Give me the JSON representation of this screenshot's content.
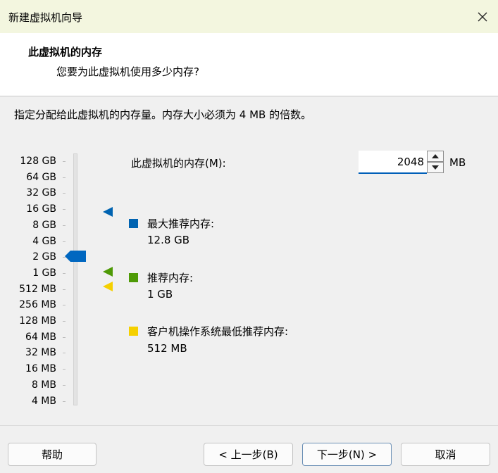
{
  "window": {
    "title": "新建虚拟机向导",
    "close_icon": "close-icon"
  },
  "header": {
    "title": "此虚拟机的内存",
    "subtitle": "您要为此虚拟机使用多少内存?"
  },
  "instruction": "指定分配给此虚拟机的内存量。内存大小必须为 4 MB 的倍数。",
  "slider": {
    "labels": [
      "128 GB",
      "64 GB",
      "32 GB",
      "16 GB",
      "8 GB",
      "4 GB",
      "2 GB",
      "1 GB",
      "512 MB",
      "256 MB",
      "128 MB",
      "64 MB",
      "32 MB",
      "16 MB",
      "8 MB",
      "4 MB"
    ],
    "selected": "2 GB"
  },
  "memory": {
    "label": "此虚拟机的内存(M):",
    "value": "2048",
    "unit": "MB"
  },
  "legend": {
    "max": {
      "title": "最大推荐内存:",
      "value": "12.8 GB",
      "color": "#0063b1"
    },
    "recommended": {
      "title": "推荐内存:",
      "value": "1 GB",
      "color": "#4e9a06"
    },
    "guest_min": {
      "title": "客户机操作系统最低推荐内存:",
      "value": "512 MB",
      "color": "#f5d000"
    }
  },
  "buttons": {
    "help": "帮助",
    "back": "< 上一步(B)",
    "next": "下一步(N) >",
    "cancel": "取消"
  }
}
